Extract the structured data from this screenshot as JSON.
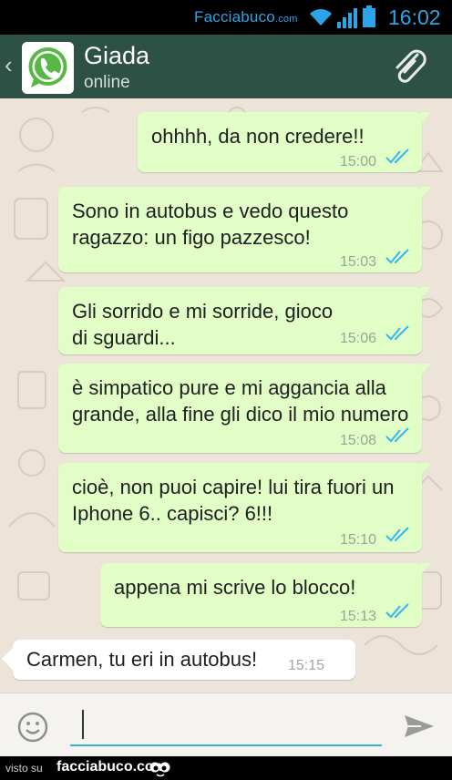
{
  "status_bar": {
    "brand": "Facciabuco",
    "brand_suffix": ".com",
    "time": "16:02",
    "icons": [
      "wifi-icon",
      "signal-icon",
      "battery-icon"
    ],
    "color": "#2aa6e8"
  },
  "header": {
    "back_symbol": "‹",
    "contact_name": "Giada",
    "contact_status": "online",
    "icons": [
      "back-chevron-icon",
      "whatsapp-avatar-icon",
      "paperclip-icon"
    ],
    "color": "#2e5146"
  },
  "messages": [
    {
      "direction": "outgoing",
      "text": "ohhhh, da non credere!!",
      "time": "15:00",
      "read": true
    },
    {
      "direction": "outgoing",
      "text": "Sono in autobus e vedo questo ragazzo: un figo pazzesco!",
      "time": "15:03",
      "read": true
    },
    {
      "direction": "outgoing",
      "text": "Gli sorrido e mi sorride, gioco di sguardi...",
      "time": "15:06",
      "read": true
    },
    {
      "direction": "outgoing",
      "text": "è simpatico pure e mi aggancia alla grande, alla fine gli dico il mio numero",
      "time": "15:08",
      "read": true
    },
    {
      "direction": "outgoing",
      "text": "cioè, non puoi capire! lui tira fuori un Iphone 6.. capisci? 6!!!",
      "time": "15:10",
      "read": true
    },
    {
      "direction": "outgoing",
      "text": "appena mi scrive lo blocco!",
      "time": "15:13",
      "read": true
    },
    {
      "direction": "incoming",
      "text": "Carmen, tu eri in autobus!",
      "time": "15:15",
      "read": false
    }
  ],
  "composer": {
    "value": "",
    "placeholder": "",
    "icons": [
      "emoji-icon",
      "send-icon"
    ],
    "accent": "#39b1cc"
  },
  "footer": {
    "visto_label": "visto su",
    "brand": "facciabuco.com"
  },
  "colors": {
    "outgoing_bubble": "#e1fec6",
    "incoming_bubble": "#ffffff",
    "chat_background": "#ece4d8",
    "read_ticks": "#34b7f1"
  }
}
